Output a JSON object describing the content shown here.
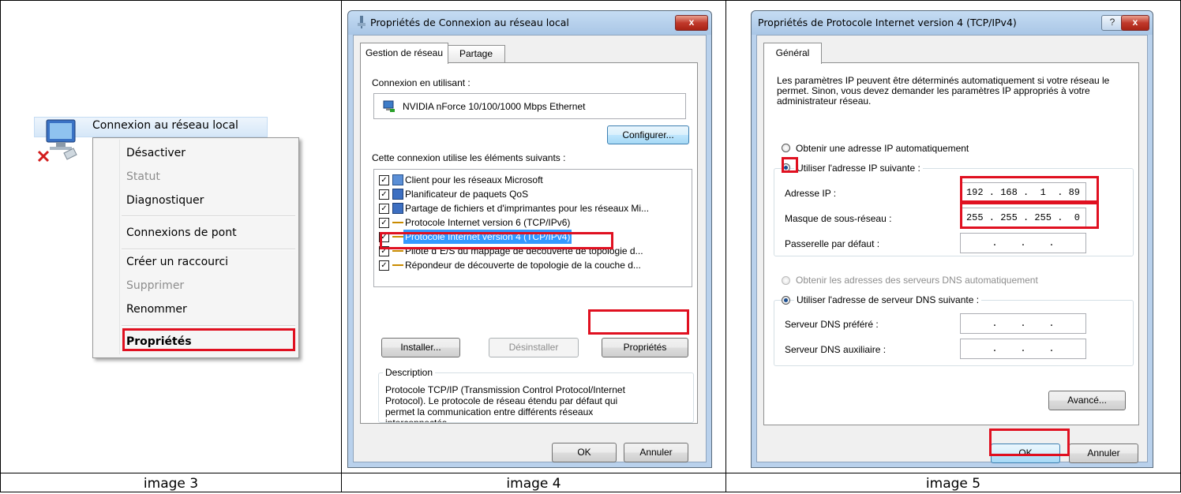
{
  "captions": [
    "image 3",
    "image 4",
    "image 5"
  ],
  "panel1": {
    "connection_label": "Connexion au réseau local",
    "menu_items": [
      {
        "label": "Désactiver",
        "state": "enabled"
      },
      {
        "label": "Statut",
        "state": "disabled"
      },
      {
        "label": "Diagnostiquer",
        "state": "enabled"
      },
      {
        "label": "Connexions de pont",
        "state": "enabled"
      },
      {
        "label": "Créer un raccourci",
        "state": "enabled"
      },
      {
        "label": "Supprimer",
        "state": "disabled"
      },
      {
        "label": "Renommer",
        "state": "enabled"
      },
      {
        "label": "Propriétés",
        "state": "bold-highlighted"
      }
    ]
  },
  "panel2": {
    "title": "Propriétés de Connexion au réseau local",
    "close_label": "x",
    "tabs": [
      "Gestion de réseau",
      "Partage"
    ],
    "connect_using_label": "Connexion en utilisant :",
    "adapter": "NVIDIA nForce 10/100/1000 Mbps Ethernet",
    "configure_label": "Configurer...",
    "items_label": "Cette connexion utilise les éléments suivants :",
    "items": [
      {
        "label": "Client pour les réseaux Microsoft",
        "checked": true,
        "icon": "network-client-icon"
      },
      {
        "label": "Planificateur de paquets QoS",
        "checked": true,
        "icon": "qos-icon"
      },
      {
        "label": "Partage de fichiers et d'imprimantes pour les réseaux Mi...",
        "checked": true,
        "icon": "file-share-icon"
      },
      {
        "label": "Protocole Internet version 6 (TCP/IPv6)",
        "checked": true,
        "icon": "protocol-icon"
      },
      {
        "label": "Protocole Internet version 4 (TCP/IPv4)",
        "checked": true,
        "icon": "protocol-icon",
        "selected": true
      },
      {
        "label": "Pilote d´E/S du mappage de découverte de topologie d...",
        "checked": true,
        "icon": "protocol-icon"
      },
      {
        "label": "Répondeur de découverte de topologie de la couche d...",
        "checked": true,
        "icon": "protocol-icon"
      }
    ],
    "install_label": "Installer...",
    "uninstall_label": "Désinstaller",
    "properties_label": "Propriétés",
    "description_label": "Description",
    "description_text": "Protocole TCP/IP (Transmission Control Protocol/Internet Protocol). Le protocole de réseau étendu par défaut qui permet la communication entre différents réseaux interconnectés.",
    "ok_label": "OK",
    "cancel_label": "Annuler"
  },
  "panel3": {
    "title": "Propriétés de Protocole Internet version 4 (TCP/IPv4)",
    "help_label": "?",
    "close_label": "x",
    "tab": "Général",
    "intro": "Les paramètres IP peuvent être déterminés automatiquement si votre réseau le permet. Sinon, vous devez demander les paramètres IP appropriés à votre administrateur réseau.",
    "auto_ip_label": "Obtenir une adresse IP automatiquement",
    "manual_ip_label": "Utiliser l'adresse IP suivante :",
    "ip_label": "Adresse IP :",
    "ip_value": "192 . 168 .  1  . 89",
    "mask_label": "Masque de sous-réseau :",
    "mask_value": "255 . 255 . 255 .  0",
    "gateway_label": "Passerelle par défaut :",
    "empty_value": " .    .    . ",
    "auto_dns_label": "Obtenir les adresses des serveurs DNS automatiquement",
    "manual_dns_label": "Utiliser l'adresse de serveur DNS suivante :",
    "dns1_label": "Serveur DNS préféré :",
    "dns2_label": "Serveur DNS auxiliaire :",
    "advanced_label": "Avancé...",
    "ok_label": "OK",
    "cancel_label": "Annuler"
  },
  "colors": {
    "highlight_red": "#e01020",
    "selection_blue": "#3399ff"
  }
}
